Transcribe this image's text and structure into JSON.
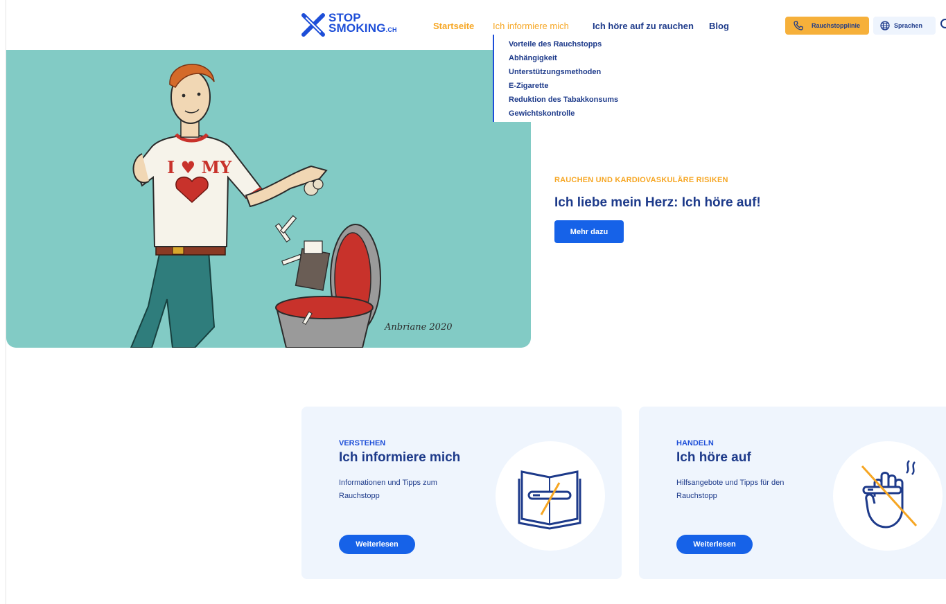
{
  "header": {
    "logo": {
      "line1": "STOP",
      "line2": "SMOKING",
      "suffix": ".CH"
    },
    "nav": {
      "home": "Startseite",
      "inform": "Ich informiere mich",
      "quit": "Ich höre auf zu rauchen",
      "blog": "Blog"
    },
    "hotline_label": "Rauchstopplinie",
    "language_label": "Sprachen"
  },
  "dropdown": {
    "items": [
      "Vorteile des Rauchstopps",
      "Abhängigkeit",
      "Unterstützungsmethoden",
      "E-Zigarette",
      "Reduktion des Tabakkonsums",
      "Gewichtskontrolle"
    ]
  },
  "hero": {
    "eyebrow": "RAUCHEN UND KARDIOVASKULÄRE RISIKEN",
    "title": "Ich liebe mein Herz: Ich höre auf!",
    "button": "Mehr dazu",
    "shirt_text": "I ♥ MY",
    "signature": "Anbriane 2020"
  },
  "cards": [
    {
      "eyebrow": "VERSTEHEN",
      "title": "Ich informiere mich",
      "text": "Informationen und Tipps zum Rauchstopp",
      "button": "Weiterlesen",
      "icon": "book-cigarette-icon"
    },
    {
      "eyebrow": "HANDELN",
      "title": "Ich höre auf",
      "text": "Hilfsangebote und Tipps für den Rauchstopp",
      "button": "Weiterlesen",
      "icon": "hand-no-smoking-icon"
    }
  ],
  "colors": {
    "primary": "#1662e8",
    "navy": "#1d3a8a",
    "accent": "#f6a623",
    "hero_bg": "#82cbc5",
    "card_bg": "#eff5fd"
  }
}
